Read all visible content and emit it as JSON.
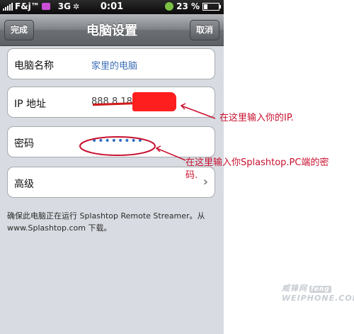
{
  "status_bar": {
    "carrier": "F&j™",
    "network": "3G",
    "time": "0:01",
    "battery": "23 %"
  },
  "nav": {
    "title": "电脑设置",
    "done_label": "完成",
    "cancel_label": "取消"
  },
  "fields": {
    "computer_name": {
      "label": "电脑名称",
      "value": "家里的电脑"
    },
    "ip_address": {
      "label": "IP 地址",
      "value": "888.8.18"
    },
    "password": {
      "label": "密码",
      "value": "••••••••"
    },
    "advanced": {
      "label": "高级"
    }
  },
  "note": "确保此电脑正在运行 Splashtop Remote Streamer。从 www.Splashtop.com 下载。",
  "annotations": {
    "ip_hint": "在这里输入你的IP.",
    "password_hint_line1": "在这里输入你Splashtop.PC端的密",
    "password_hint_line2": "码."
  },
  "watermark": {
    "cn": "威锋网",
    "badge": "feng",
    "en": "WEIPHONE.COM"
  },
  "colors": {
    "annotation_red": "#c8102e",
    "link_blue": "#3b6eb5"
  }
}
